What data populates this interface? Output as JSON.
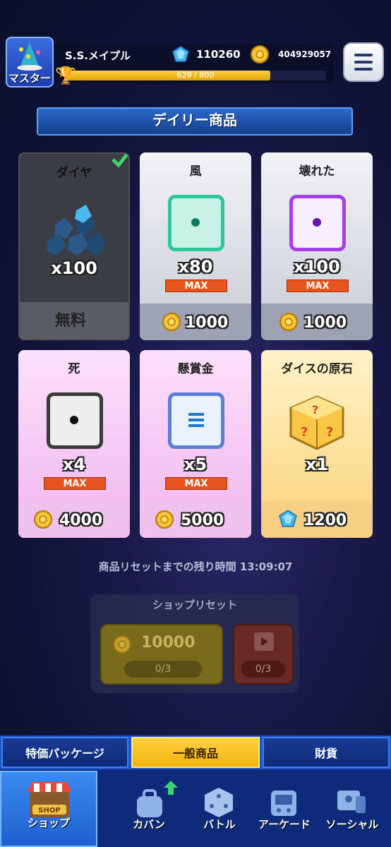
{
  "header": {
    "rank_label": "マスター",
    "player_name": "S.S.メイプル",
    "xp_text": "629 / 800",
    "xp_progress": 0.786,
    "gems": "110260",
    "coins": "404929057",
    "icons": {
      "rank": "wizard-hat-icon",
      "trophy": "trophy-icon",
      "gem": "gem-icon",
      "coin": "coin-icon",
      "menu": "hamburger-menu-icon"
    }
  },
  "daily": {
    "title": "デイリー商品"
  },
  "products": [
    {
      "name": "ダイヤ",
      "qty": "x100",
      "price": "無料",
      "currency": "free",
      "purchased": true
    },
    {
      "name": "風",
      "qty": "x80",
      "max": "MAX",
      "price": "1000",
      "currency": "coin"
    },
    {
      "name": "壊れた",
      "qty": "x100",
      "max": "MAX",
      "price": "1000",
      "currency": "coin"
    },
    {
      "name": "死",
      "qty": "x4",
      "max": "MAX",
      "price": "4000",
      "currency": "coin"
    },
    {
      "name": "懸賞金",
      "qty": "x5",
      "max": "MAX",
      "price": "5000",
      "currency": "coin"
    },
    {
      "name": "ダイスの原石",
      "qty": "x1",
      "price": "1200",
      "currency": "gem"
    }
  ],
  "reset": {
    "timer_text": "商品リセットまでの残り時間 13:09:07",
    "shop_reset_title": "ショップリセット",
    "coin_cost": "10000",
    "coin_count": "0/3",
    "ad_count": "0/3"
  },
  "tabs": [
    {
      "label": "特価パッケージ"
    },
    {
      "label": "一般商品",
      "active": true
    },
    {
      "label": "財貨"
    }
  ],
  "nav": [
    {
      "label": "ショップ",
      "active": true,
      "icon": "shop-stall-icon",
      "badge": "SHOP"
    },
    {
      "label": "カバン",
      "icon": "bag-icon"
    },
    {
      "label": "バトル",
      "icon": "dice-icon"
    },
    {
      "label": "アーケード",
      "icon": "arcade-icon"
    },
    {
      "label": "ソーシャル",
      "icon": "social-icon"
    }
  ],
  "colors": {
    "accent": "#f3b20d",
    "max_badge": "#e8541e",
    "nav_bg": "#0e2a7a"
  }
}
